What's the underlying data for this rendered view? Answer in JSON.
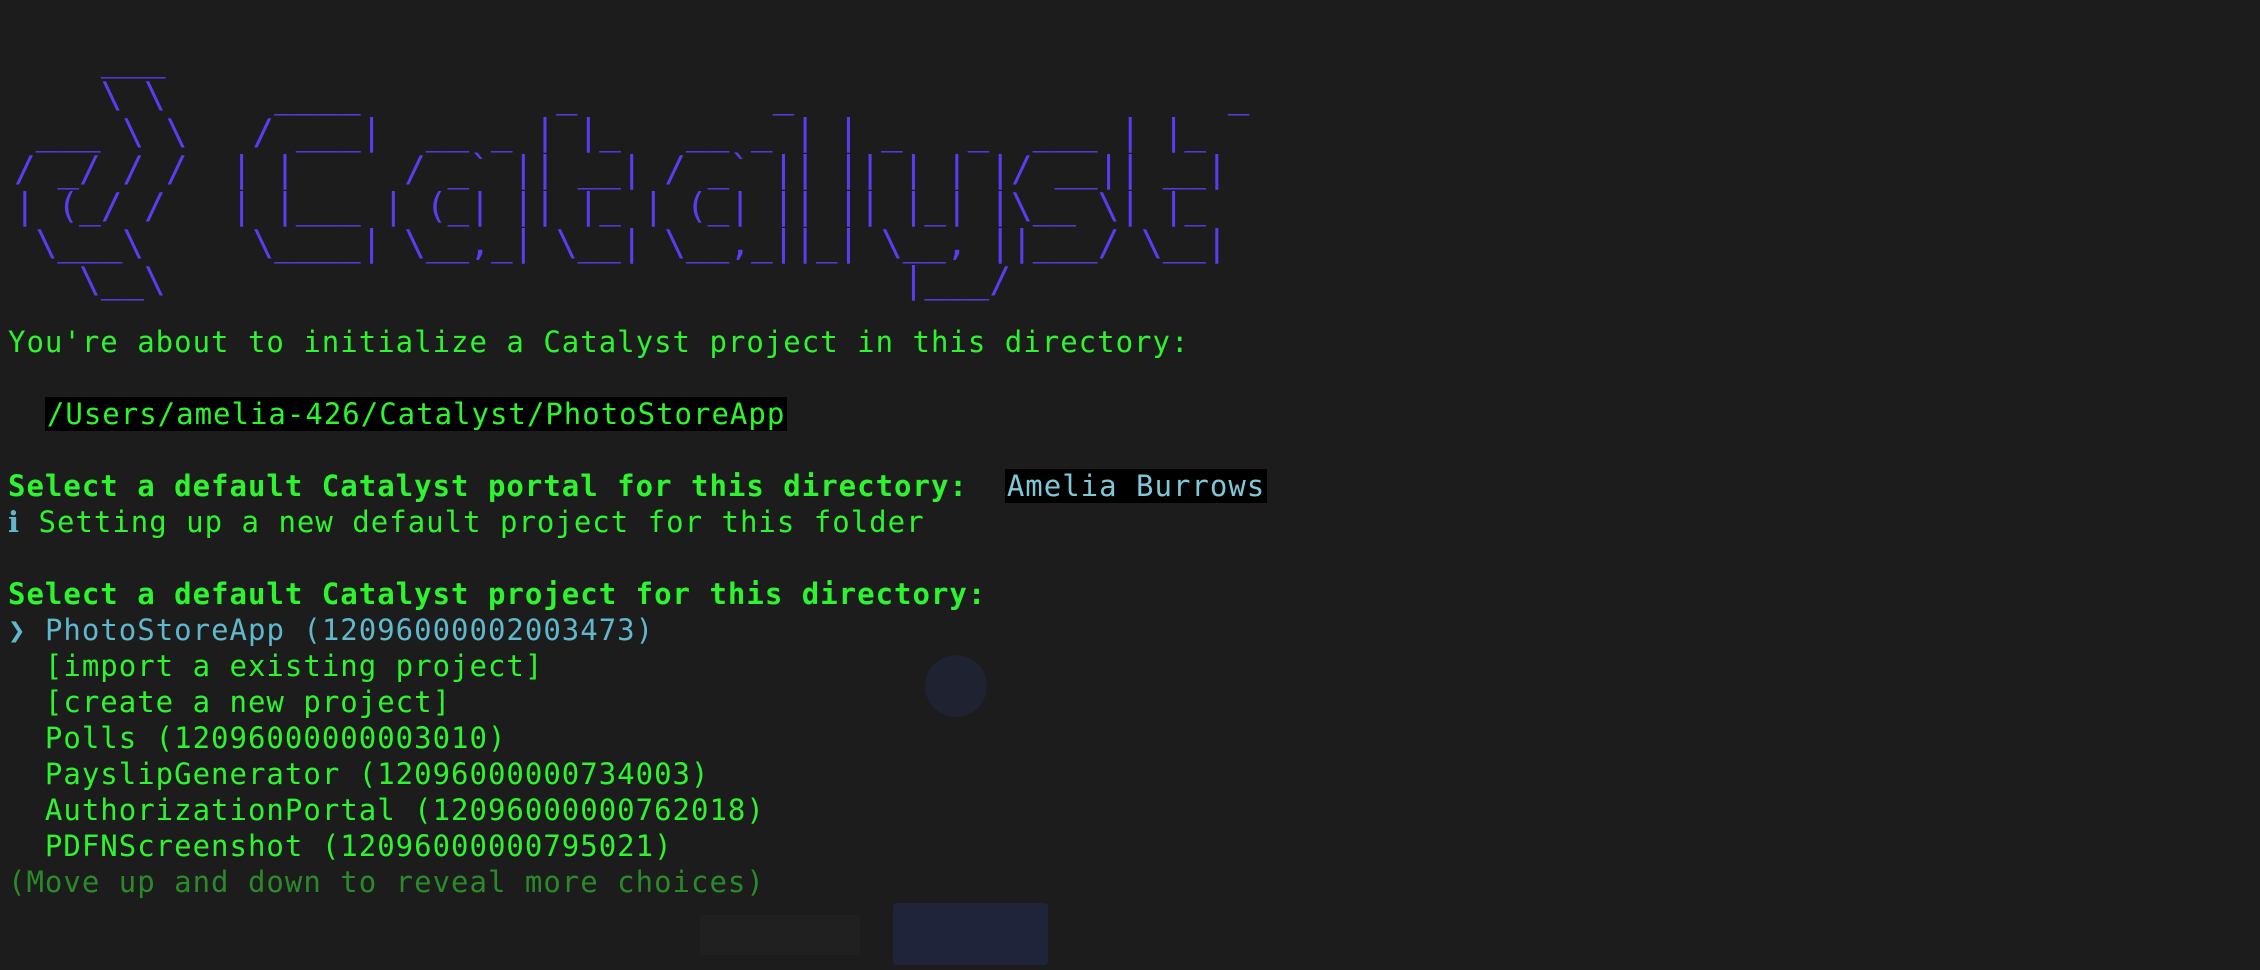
{
  "colors": {
    "background": "#1c1c1c",
    "green": "#2df52d",
    "cyan": "#5fb8cc",
    "purple": "#5a3df0",
    "dim_green": "#2a8a2a"
  },
  "banner": {
    "logo_text": "Catalyst"
  },
  "intro": {
    "message": "You're about to initialize a Catalyst project in this directory:",
    "directory": "/Users/amelia-426/Catalyst/PhotoStoreApp"
  },
  "portal_prompt": {
    "question": "Select a default Catalyst portal for this directory:",
    "answer": "Amelia Burrows"
  },
  "info": {
    "icon": "info-icon",
    "symbol": "ℹ",
    "message": "Setting up a new default project for this folder"
  },
  "project_prompt": {
    "question": "Select a default Catalyst project for this directory:",
    "cursor": "❯",
    "choices": [
      "PhotoStoreApp (12096000002003473)",
      "[import a existing project]",
      "[create a new project]",
      "Polls (12096000000003010)",
      "PayslipGenerator (12096000000734003)",
      "AuthorizationPortal (12096000000762018)",
      "PDFNScreenshot (12096000000795021)"
    ],
    "hint": "(Move up and down to reveal more choices)"
  }
}
